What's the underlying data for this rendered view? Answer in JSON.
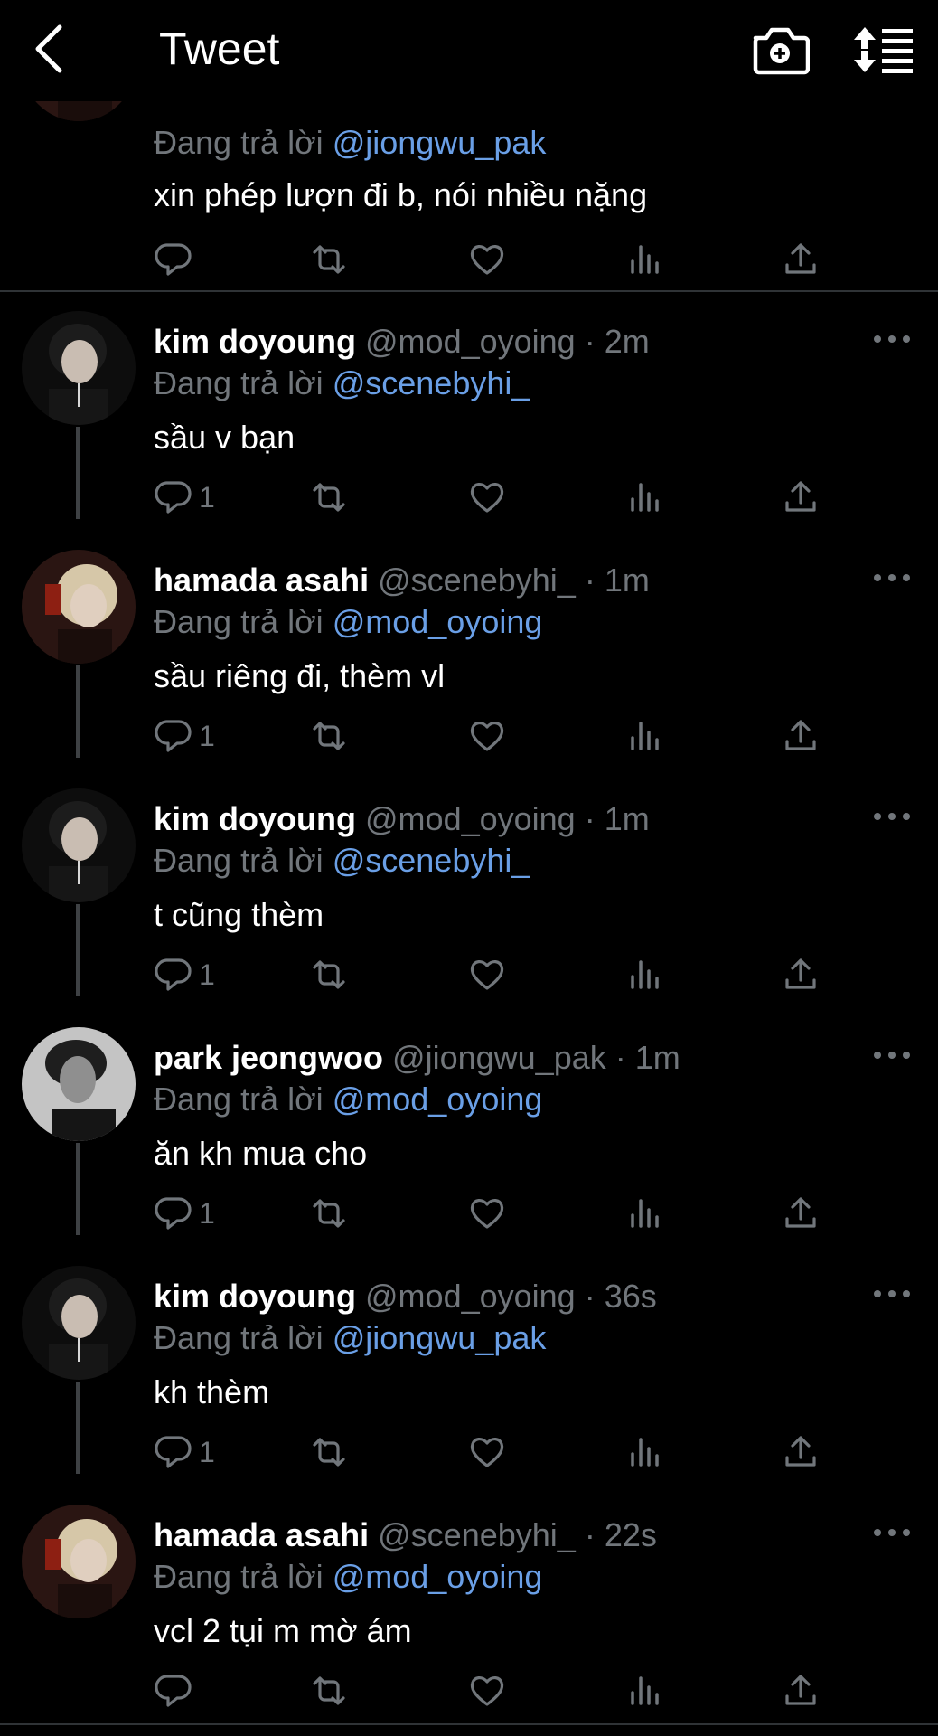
{
  "header": {
    "title": "Tweet",
    "back_icon": "chevron-left-icon",
    "camera_icon": "camera-plus-icon",
    "sort_icon": "sort-list-icon"
  },
  "colors": {
    "background": "#000000",
    "text": "#ffffff",
    "muted": "#71767b",
    "link": "#6a9fe6",
    "divider": "#2f3336"
  },
  "tweets": [
    {
      "display_name": "",
      "handle": "",
      "time": "",
      "reply_prefix": "Đang trả lời",
      "reply_to": "@jiongwu_pak",
      "text": "xin phép lượn đi b, nói nhiều nặng",
      "reply_count": "",
      "avatar": "blonde"
    },
    {
      "display_name": "kim doyoung",
      "handle": "@mod_oyoing",
      "time": "2m",
      "reply_prefix": "Đang trả lời",
      "reply_to": "@scenebyhi_",
      "text": "sầu v bạn",
      "reply_count": "1",
      "avatar": "dark"
    },
    {
      "display_name": "hamada asahi",
      "handle": "@scenebyhi_",
      "time": "1m",
      "reply_prefix": "Đang trả lời",
      "reply_to": "@mod_oyoing",
      "text": "sầu riêng đi, thèm vl",
      "reply_count": "1",
      "avatar": "blonde"
    },
    {
      "display_name": "kim doyoung",
      "handle": "@mod_oyoing",
      "time": "1m",
      "reply_prefix": "Đang trả lời",
      "reply_to": "@scenebyhi_",
      "text": "t cũng thèm",
      "reply_count": "1",
      "avatar": "dark"
    },
    {
      "display_name": "park jeongwoo",
      "handle": "@jiongwu_pak",
      "time": "1m",
      "reply_prefix": "Đang trả lời",
      "reply_to": "@mod_oyoing",
      "text": "ăn kh mua cho",
      "reply_count": "1",
      "avatar": "gray"
    },
    {
      "display_name": "kim doyoung",
      "handle": "@mod_oyoing",
      "time": "36s",
      "reply_prefix": "Đang trả lời",
      "reply_to": "@jiongwu_pak",
      "text": "kh thèm",
      "reply_count": "1",
      "avatar": "dark"
    },
    {
      "display_name": "hamada asahi",
      "handle": "@scenebyhi_",
      "time": "22s",
      "reply_prefix": "Đang trả lời",
      "reply_to": "@mod_oyoing",
      "text": "vcl 2 tụi m mờ ám",
      "reply_count": "",
      "avatar": "blonde"
    }
  ],
  "action_icons": [
    "reply-icon",
    "retweet-icon",
    "like-icon",
    "views-icon",
    "share-icon"
  ]
}
